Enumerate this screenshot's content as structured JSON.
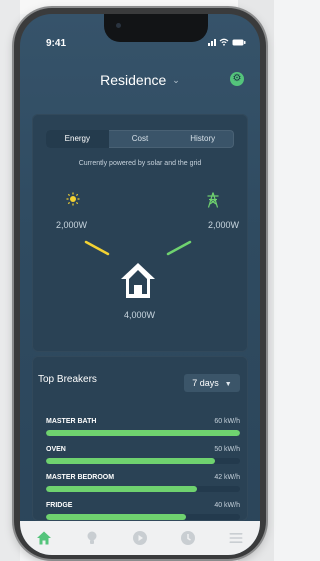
{
  "status": {
    "time": "9:41"
  },
  "header": {
    "title": "Residence"
  },
  "tabs": [
    {
      "label": "Energy",
      "active": true
    },
    {
      "label": "Cost",
      "active": false
    },
    {
      "label": "History",
      "active": false
    }
  ],
  "energy": {
    "subtitle": "Currently powered by solar and the grid",
    "solar_watts": "2,000W",
    "grid_watts": "2,000W",
    "home_watts": "4,000W"
  },
  "breakers": {
    "title": "Top Breakers",
    "range_label": "7 days",
    "items": [
      {
        "name": "MASTER BATH",
        "value": "60 kW/h",
        "fraction": 1.0
      },
      {
        "name": "OVEN",
        "value": "50 kW/h",
        "fraction": 0.87
      },
      {
        "name": "MASTER BEDROOM",
        "value": "42 kW/h",
        "fraction": 0.78
      },
      {
        "name": "FRIDGE",
        "value": "40 kW/h",
        "fraction": 0.72
      }
    ]
  },
  "nav": {
    "items": [
      {
        "icon": "home-icon",
        "active": true
      },
      {
        "icon": "bulb-icon",
        "active": false
      },
      {
        "icon": "play-icon",
        "active": false
      },
      {
        "icon": "clock-icon",
        "active": false
      },
      {
        "icon": "menu-icon",
        "active": false
      }
    ]
  },
  "colors": {
    "accent_green": "#54c47b",
    "bar_green": "#6fd26f",
    "sun_yellow": "#f3d233",
    "card_bg": "#2a4255"
  }
}
